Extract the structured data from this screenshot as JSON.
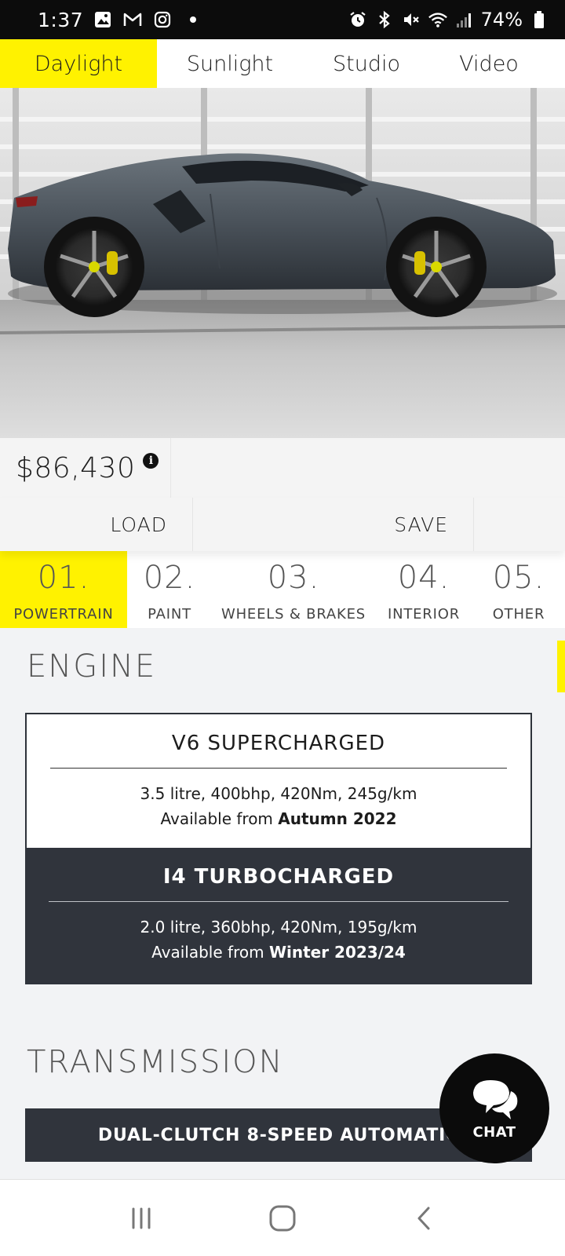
{
  "status_bar": {
    "time": "1:37",
    "battery": "74%",
    "left_icons": [
      "gallery-icon",
      "gmail-icon",
      "instagram-icon",
      "dot-icon"
    ],
    "right_icons": [
      "alarm-icon",
      "bluetooth-icon",
      "mute-icon",
      "wifi-icon",
      "signal-icon",
      "battery-icon"
    ]
  },
  "lighting_tabs": [
    {
      "label": "Daylight",
      "active": true
    },
    {
      "label": "Sunlight",
      "active": false
    },
    {
      "label": "Studio",
      "active": false
    },
    {
      "label": "Video",
      "active": false
    }
  ],
  "price": {
    "value": "$86,430",
    "info_icon": "info-icon"
  },
  "actions": {
    "load_label": "LOAD",
    "save_label": "SAVE"
  },
  "steps": [
    {
      "number": "01.",
      "label": "POWERTRAIN",
      "active": true
    },
    {
      "number": "02.",
      "label": "PAINT",
      "active": false
    },
    {
      "number": "03.",
      "label": "WHEELS & BRAKES",
      "active": false
    },
    {
      "number": "04.",
      "label": "INTERIOR",
      "active": false
    },
    {
      "number": "05.",
      "label": "OTHER",
      "active": false
    }
  ],
  "engine": {
    "section_title": "ENGINE",
    "options": [
      {
        "title": "V6 SUPERCHARGED",
        "spec": "3.5 litre, 400bhp, 420Nm, 245g/km",
        "available_prefix": "Available from",
        "available_when": "Autumn 2022",
        "selected": false
      },
      {
        "title": "I4 TURBOCHARGED",
        "spec": "2.0 litre, 360bhp, 420Nm, 195g/km",
        "available_prefix": "Available from",
        "available_when": "Winter 2023/24",
        "selected": true
      }
    ]
  },
  "transmission": {
    "section_title": "TRANSMISSION",
    "option_label": "DUAL-CLUTCH 8-SPEED AUTOMATIC"
  },
  "chat": {
    "label": "CHAT",
    "icon": "chat-bubbles-icon"
  },
  "nav_bar": {
    "buttons": [
      "recent-apps-icon",
      "home-icon",
      "back-icon"
    ]
  },
  "colors": {
    "accent_yellow": "#fff200",
    "dark_panel": "#30343c",
    "page_bg": "#f2f3f5"
  }
}
